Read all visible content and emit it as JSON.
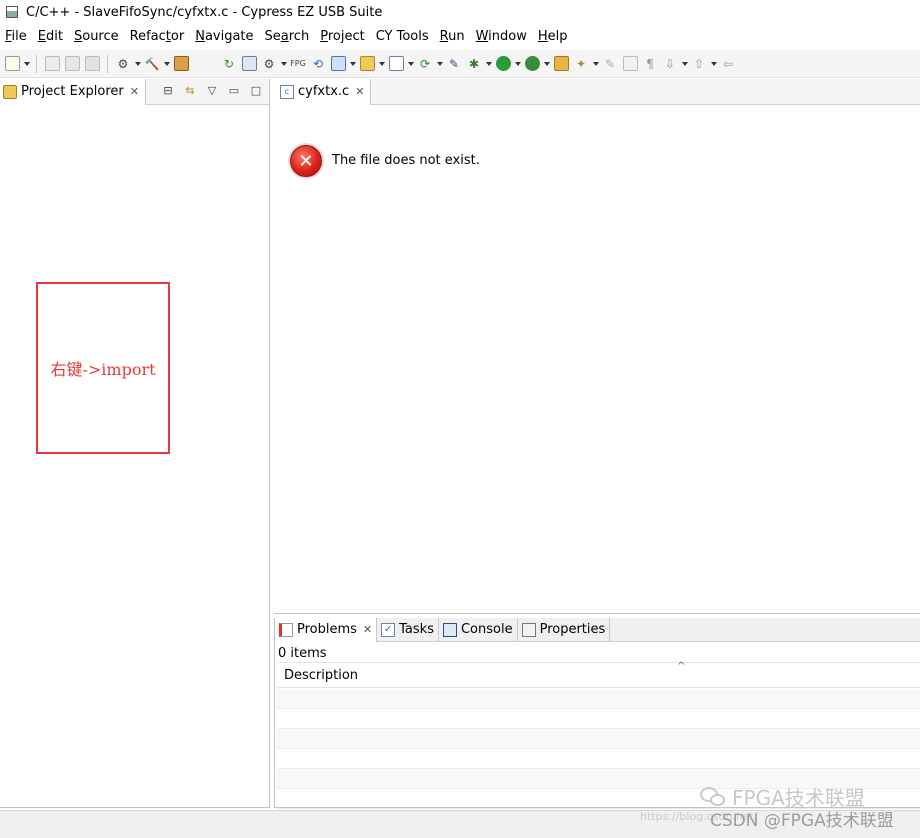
{
  "window": {
    "title": "C/C++ - SlaveFifoSync/cyfxtx.c - Cypress EZ USB Suite"
  },
  "menubar": {
    "items": [
      {
        "label": "File",
        "underline": "F",
        "rest": "ile"
      },
      {
        "label": "Edit",
        "underline": "E",
        "rest": "dit"
      },
      {
        "label": "Source",
        "underline": "S",
        "rest": "ource"
      },
      {
        "label": "Refactor",
        "pre": "Refac",
        "underline": "t",
        "rest": "or"
      },
      {
        "label": "Navigate",
        "underline": "N",
        "rest": "avigate"
      },
      {
        "label": "Search",
        "pre": "Se",
        "underline": "a",
        "rest": "rch"
      },
      {
        "label": "Project",
        "underline": "P",
        "rest": "roject"
      },
      {
        "label": "CY Tools",
        "underline": "",
        "rest": "CY Tools"
      },
      {
        "label": "Run",
        "underline": "R",
        "rest": "un"
      },
      {
        "label": "Window",
        "underline": "W",
        "rest": "indow"
      },
      {
        "label": "Help",
        "underline": "H",
        "rest": "elp"
      }
    ]
  },
  "project_explorer": {
    "tab_label": "Project Explorer",
    "annotation": "右键->import"
  },
  "editor": {
    "tab_label": "cyfxtx.c",
    "error_message": "The file does not exist."
  },
  "bottom_panel": {
    "tabs": [
      {
        "label": "Problems",
        "active": true
      },
      {
        "label": "Tasks",
        "active": false
      },
      {
        "label": "Console",
        "active": false
      },
      {
        "label": "Properties",
        "active": false
      }
    ],
    "items_count": "0 items",
    "column_header": "Description"
  },
  "watermark": {
    "top": "FPGA技术联盟",
    "bottom_faint": "https://blog.csdn.net/",
    "bottom_strong": "CSDN @FPGA技术联盟"
  },
  "colors": {
    "annotation": "#e53b3b",
    "error_icon": "#d9231b"
  }
}
